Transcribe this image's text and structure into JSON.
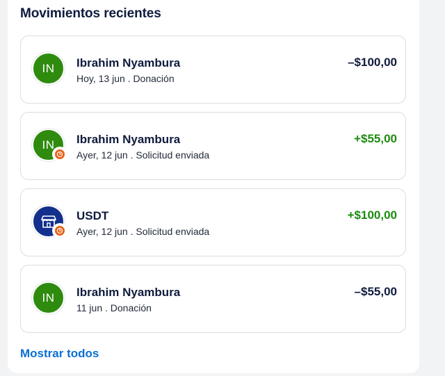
{
  "section": {
    "title": "Movimientos recientes"
  },
  "transactions": [
    {
      "avatar": "IN",
      "name": "Ibrahim Nyambura",
      "meta": "Hoy, 13 jun . Donación",
      "amount": "–$100,00",
      "direction": "outgoing",
      "pending": false
    },
    {
      "avatar": "IN",
      "name": "Ibrahim Nyambura",
      "meta": "Ayer, 12 jun . Solicitud enviada",
      "amount": "+$55,00",
      "direction": "incoming",
      "pending": true
    },
    {
      "avatar_icon": "storefront-icon",
      "name": "USDT",
      "meta": "Ayer, 12 jun . Solicitud enviada",
      "amount": "+$100,00",
      "direction": "incoming",
      "pending": true
    },
    {
      "avatar": "IN",
      "name": "Ibrahim Nyambura",
      "meta": "11 jun . Donación",
      "amount": "–$55,00",
      "direction": "outgoing",
      "pending": false
    }
  ],
  "footer": {
    "show_all_label": "Mostrar todos"
  },
  "colors": {
    "title": "#0f1b3d",
    "positive": "#1d8a10",
    "link": "#0a6fd4",
    "avatar_green": "#2e8b0e",
    "avatar_blue": "#12308c",
    "pending_badge": "#e5621d"
  }
}
